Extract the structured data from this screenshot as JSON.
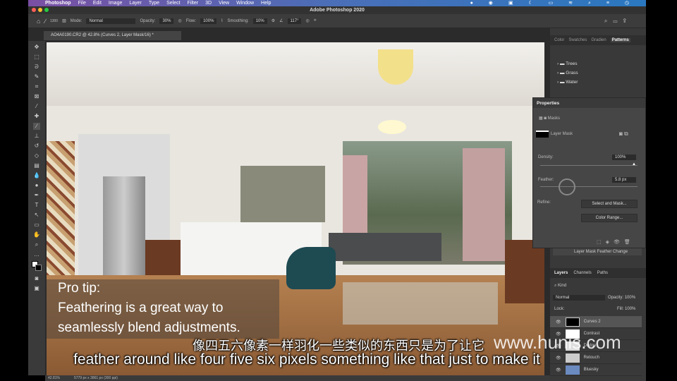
{
  "menu": {
    "app": "Photoshop",
    "items": [
      "File",
      "Edit",
      "Image",
      "Layer",
      "Type",
      "Select",
      "Filter",
      "3D",
      "View",
      "Window",
      "Help"
    ]
  },
  "window_title": "Adobe Photoshop 2020",
  "options": {
    "brush_size": "1300",
    "mode_label": "Mode:",
    "mode": "Normal",
    "opacity_label": "Opacity:",
    "opacity": "30%",
    "flow_label": "Flow:",
    "flow": "100%",
    "smoothing_label": "Smoothing:",
    "smoothing": "10%",
    "angle": "117°"
  },
  "doc_tab": "AO4A0190.CR2 @ 42.8% (Curves 2, Layer Mask/16) *",
  "status": {
    "zoom": "42.81%",
    "dims": "5779 px x 3861 px (300 ppi)"
  },
  "panel_tabs": [
    "Color",
    "Swatches",
    "Gradien",
    "Patterns"
  ],
  "patterns": [
    "Trees",
    "Grass",
    "Water"
  ],
  "properties": {
    "title": "Properties",
    "section": "Masks",
    "layer_mask": "Layer Mask",
    "density_label": "Density:",
    "density": "100%",
    "feather_label": "Feather:",
    "feather": "5.8 px",
    "feather_fraction": 0.1,
    "refine_label": "Refine:",
    "select_mask": "Select and Mask...",
    "color_range": "Color Range..."
  },
  "history_item": "Layer Mask Feather Change",
  "layers": {
    "tabs": [
      "Layers",
      "Channels",
      "Paths"
    ],
    "kind": "Kind",
    "blend": "Normal",
    "opacity_label": "Opacity:",
    "opacity": "100%",
    "lock_label": "Lock:",
    "fill_label": "Fill:",
    "fill": "100%",
    "items": [
      "Curves 2",
      "Contrast",
      "Dodge",
      "Retouch",
      "Bluesky"
    ]
  },
  "overlay": {
    "pro_tip": "Pro tip:",
    "line1": "Feathering is a great way to",
    "line2": "seamlessly blend adjustments."
  },
  "subtitles": {
    "zh": "像四五六像素一样羽化一些类似的东西只是为了让它",
    "en": "feather around like four five six pixels something like that just to make it"
  },
  "watermark": "www.hunis.com"
}
